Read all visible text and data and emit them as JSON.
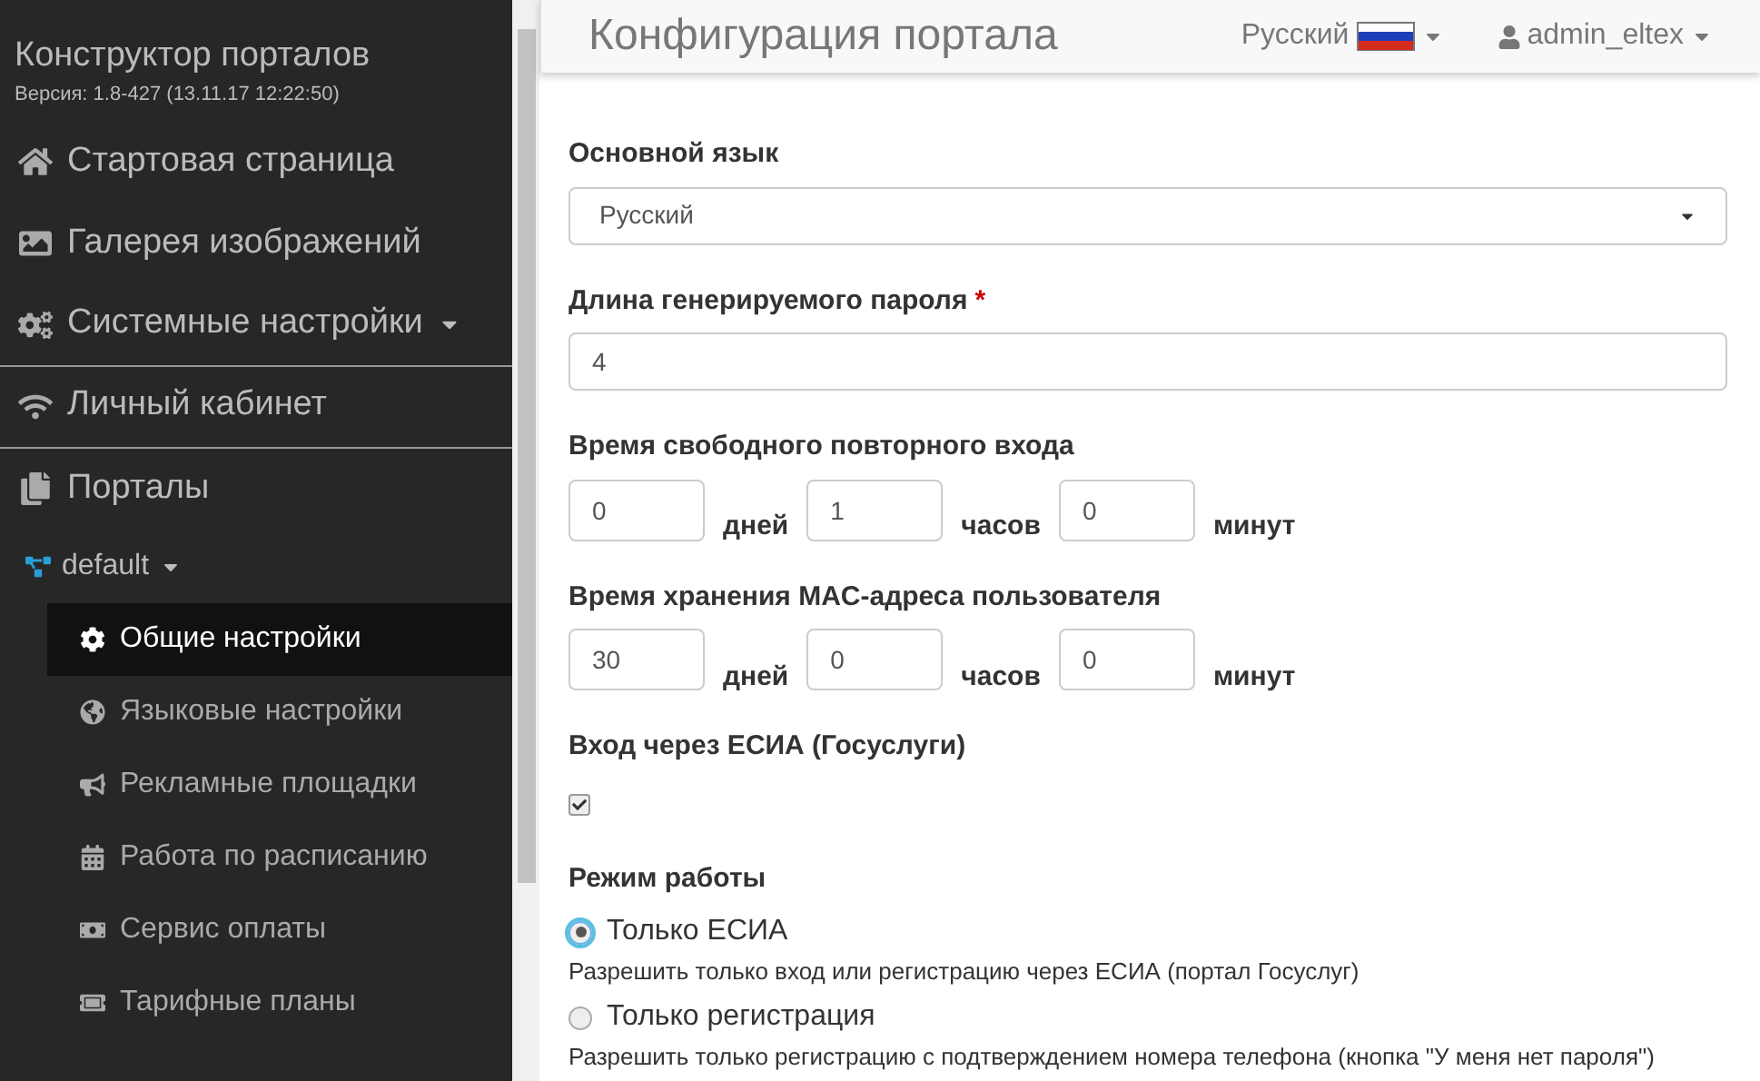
{
  "sidebar": {
    "title": "Конструктор порталов",
    "version": "Версия: 1.8-427 (13.11.17 12:22:50)",
    "items": [
      {
        "label": "Стартовая страница",
        "dropdown": false,
        "divider_after": false
      },
      {
        "label": "Галерея изображений",
        "dropdown": false,
        "divider_after": false
      },
      {
        "label": "Системные настройки",
        "dropdown": true,
        "divider_after": true
      },
      {
        "label": "Личный кабинет",
        "dropdown": false,
        "divider_after": true
      },
      {
        "label": "Порталы",
        "dropdown": false,
        "divider_after": false
      }
    ],
    "portal": {
      "label": "default",
      "expanded": true,
      "children": [
        {
          "label": "Общие настройки",
          "selected": true
        },
        {
          "label": "Языковые настройки",
          "selected": false
        },
        {
          "label": "Рекламные площадки",
          "selected": false
        },
        {
          "label": "Работа по расписанию",
          "selected": false
        },
        {
          "label": "Сервис оплаты",
          "selected": false
        },
        {
          "label": "Тарифные планы",
          "selected": false
        }
      ]
    }
  },
  "header": {
    "title": "Конфигурация портала",
    "language": "Русский",
    "user": "admin_eltex"
  },
  "form": [
    {
      "kind": "select",
      "label": "Основной язык",
      "value": "Русский"
    },
    {
      "kind": "text",
      "label": "Длина генерируемого пароля",
      "required_mark": "*",
      "value": "4"
    },
    {
      "kind": "duration",
      "label": "Время свободного повторного входа",
      "parts": [
        {
          "value": "0",
          "unit": "дней"
        },
        {
          "value": "1",
          "unit": "часов"
        },
        {
          "value": "0",
          "unit": "минут"
        }
      ]
    },
    {
      "kind": "duration",
      "label": "Время хранения MAC-адреса пользователя",
      "parts": [
        {
          "value": "30",
          "unit": "дней"
        },
        {
          "value": "0",
          "unit": "часов"
        },
        {
          "value": "0",
          "unit": "минут"
        }
      ]
    },
    {
      "kind": "checkbox",
      "label": "Вход через ЕСИА (Госуслуги)",
      "checked": true
    },
    {
      "kind": "radio",
      "label": "Режим работы",
      "options": [
        {
          "label": "Только ЕСИА",
          "hint": "Разрешить только вход или регистрацию через ЕСИА (портал Госуслуг)",
          "selected": true
        },
        {
          "label": "Только регистрация",
          "hint": "Разрешить только регистрацию с подтверждением номера телефона (кнопка \"У меня нет пароля\")",
          "selected": false
        }
      ]
    }
  ]
}
